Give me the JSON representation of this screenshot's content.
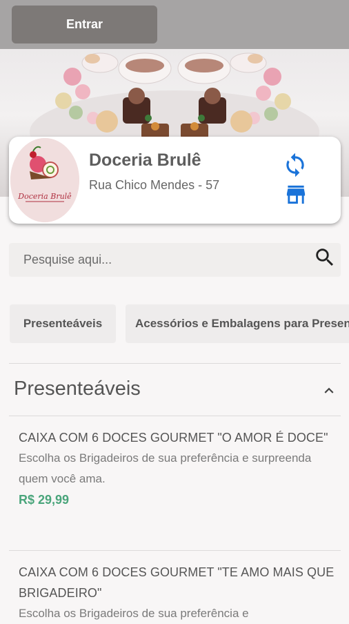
{
  "header": {
    "login_label": "Entrar"
  },
  "store": {
    "name": "Doceria Brulê",
    "address": "Rua Chico Mendes - 57",
    "logo_text": "Doceria Brulê"
  },
  "search": {
    "placeholder": "Pesquise aqui..."
  },
  "categories": [
    {
      "label": "Presenteáveis"
    },
    {
      "label": "Acessórios e Embalagens para Presentes"
    }
  ],
  "section": {
    "title": "Presenteáveis"
  },
  "products": [
    {
      "name": "CAIXA COM 6 DOCES GOURMET \"O AMOR É DOCE\"",
      "description": "Escolha os Brigadeiros de sua preferência e surpreenda quem você ama.",
      "price": "R$ 29,99"
    },
    {
      "name": "CAIXA COM 6 DOCES GOURMET \"TE AMO MAIS QUE BRIGADEIRO\"",
      "description": "Escolha os Brigadeiros de sua preferência e",
      "price": ""
    }
  ],
  "colors": {
    "accent_blue": "#1a73d9",
    "price_green": "#4aa57b",
    "topbar": "#a6a4a4",
    "login_button": "#7d7977"
  },
  "icons": {
    "refresh": "refresh-icon",
    "storefront": "storefront-icon",
    "search": "search-icon",
    "collapse": "chevron-up-icon"
  }
}
